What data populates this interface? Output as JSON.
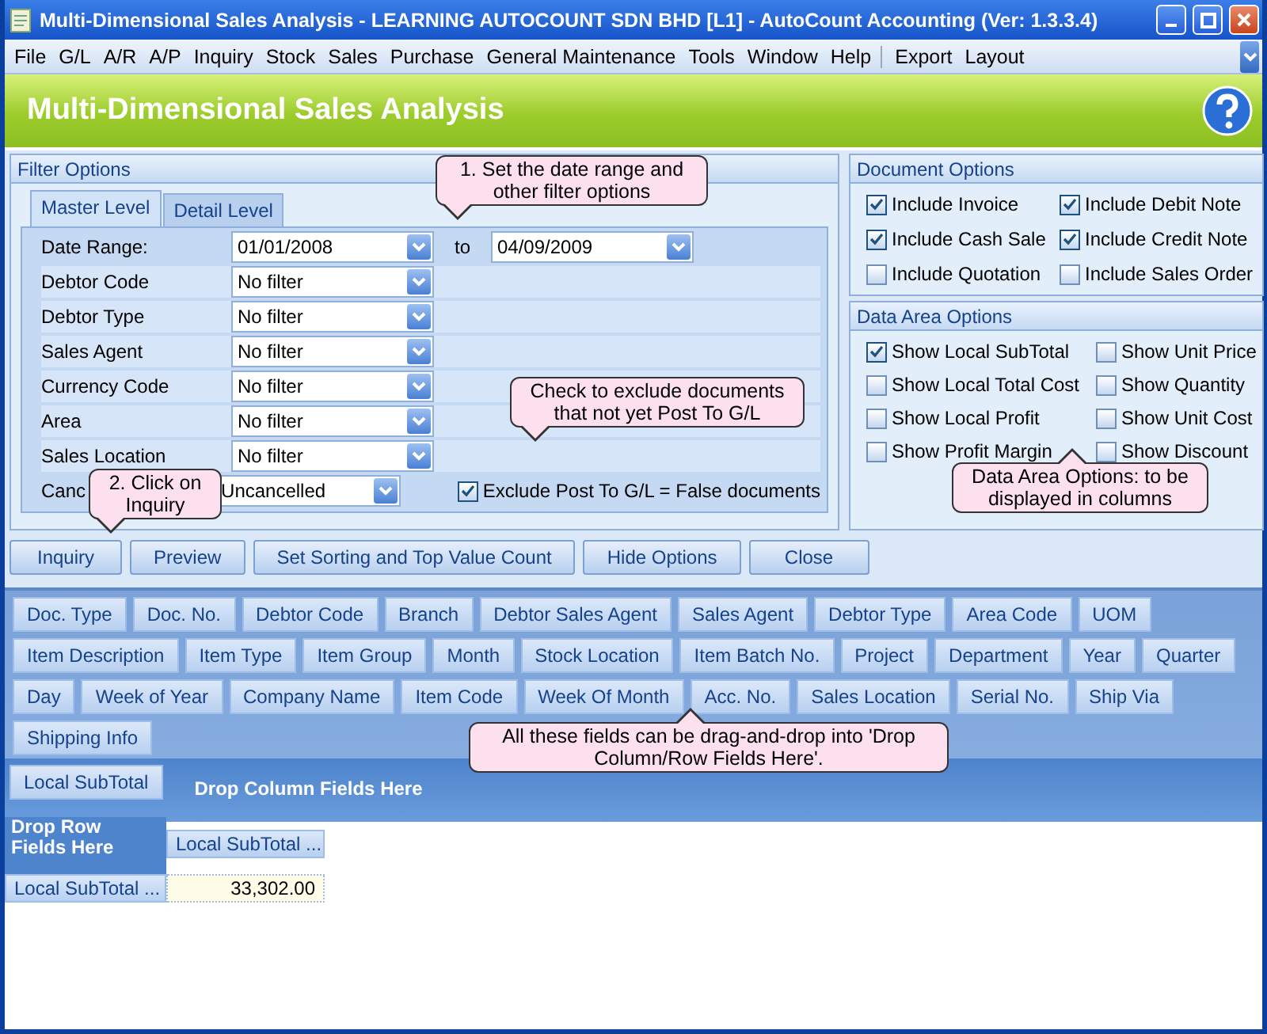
{
  "window": {
    "title": "Multi-Dimensional Sales Analysis - LEARNING AUTOCOUNT SDN BHD [L1] - AutoCount Accounting (Ver: 1.3.3.4)"
  },
  "menu": [
    {
      "label": "File",
      "separator_before": false
    },
    {
      "label": "G/L",
      "separator_before": false
    },
    {
      "label": "A/R",
      "separator_before": false
    },
    {
      "label": "A/P",
      "separator_before": false
    },
    {
      "label": "Inquiry",
      "separator_before": false
    },
    {
      "label": "Stock",
      "separator_before": false
    },
    {
      "label": "Sales",
      "separator_before": false
    },
    {
      "label": "Purchase",
      "separator_before": false
    },
    {
      "label": "General Maintenance",
      "separator_before": false
    },
    {
      "label": "Tools",
      "separator_before": false
    },
    {
      "label": "Window",
      "separator_before": false
    },
    {
      "label": "Help",
      "separator_before": false
    },
    {
      "label": "Export",
      "separator_before": true
    },
    {
      "label": "Layout",
      "separator_before": false
    }
  ],
  "header": {
    "title": "Multi-Dimensional Sales Analysis"
  },
  "filter_options": {
    "title": "Filter Options",
    "tabs": [
      {
        "label": "Master Level",
        "selected": true
      },
      {
        "label": "Detail Level",
        "selected": false
      }
    ],
    "date_range": {
      "label": "Date Range:",
      "from": "01/01/2008",
      "to_label": "to",
      "to": "04/09/2009"
    },
    "filters": [
      {
        "label": "Debtor Code",
        "value": "No filter"
      },
      {
        "label": "Debtor Type",
        "value": "No filter"
      },
      {
        "label": "Sales Agent",
        "value": "No filter"
      },
      {
        "label": "Currency Code",
        "value": "No filter"
      },
      {
        "label": "Area",
        "value": "No filter"
      },
      {
        "label": "Sales Location",
        "value": "No filter"
      },
      {
        "label": "Canc",
        "value": "Uncancelled"
      }
    ],
    "exclude": {
      "label": "Exclude Post To G/L = False documents",
      "checked": true
    }
  },
  "document_options": {
    "title": "Document Options",
    "items": [
      {
        "label": "Include Invoice",
        "checked": true
      },
      {
        "label": "Include Debit Note",
        "checked": true
      },
      {
        "label": "Include Cash Sale",
        "checked": true
      },
      {
        "label": "Include Credit Note",
        "checked": true
      },
      {
        "label": "Include Quotation",
        "checked": false
      },
      {
        "label": "Include Sales Order",
        "checked": false
      }
    ]
  },
  "data_area_options": {
    "title": "Data Area Options",
    "items": [
      {
        "label": "Show Local SubTotal",
        "checked": true
      },
      {
        "label": "Show Unit Price",
        "checked": false
      },
      {
        "label": "Show Local Total Cost",
        "checked": false
      },
      {
        "label": "Show Quantity",
        "checked": false
      },
      {
        "label": "Show Local Profit",
        "checked": false
      },
      {
        "label": "Show Unit Cost",
        "checked": false
      },
      {
        "label": "Show Profit Margin",
        "checked": false
      },
      {
        "label": "Show Discount",
        "checked": false
      }
    ]
  },
  "buttons": [
    "Inquiry",
    "Preview",
    "Set Sorting and Top Value Count",
    "Hide Options",
    "Close"
  ],
  "field_rows": [
    [
      "Doc. Type",
      "Doc. No.",
      "Debtor Code",
      "Branch",
      "Debtor Sales Agent",
      "Sales Agent",
      "Debtor Type",
      "Area Code",
      "UOM"
    ],
    [
      "Item Description",
      "Item Type",
      "Item Group",
      "Month",
      "Stock Location",
      "Item Batch No.",
      "Project",
      "Department",
      "Year",
      "Quarter"
    ],
    [
      "Day",
      "Week of Year",
      "Company Name",
      "Item Code",
      "Week Of Month",
      "Acc. No.",
      "Sales Location",
      "Serial No.",
      "Ship Via"
    ],
    [
      "Shipping Info"
    ]
  ],
  "pivot": {
    "data_field": "Local SubTotal",
    "column_drop": "Drop Column Fields Here",
    "row_drop": "Drop Row Fields Here",
    "column_header": "Local SubTotal ...",
    "row_header": "Local SubTotal ...",
    "value": "33,302.00"
  },
  "callouts": [
    {
      "text": "1. Set the date range and other filter options",
      "kind": "down"
    },
    {
      "text": "Check to exclude documents that not yet Post To G/L",
      "kind": "down"
    },
    {
      "text": "2. Click on Inquiry",
      "kind": "down"
    },
    {
      "text": "Data Area Options: to be displayed  in columns",
      "kind": "up"
    },
    {
      "text": "All these fields can be drag-and-drop into 'Drop Column/Row Fields Here'.",
      "kind": "up"
    }
  ]
}
